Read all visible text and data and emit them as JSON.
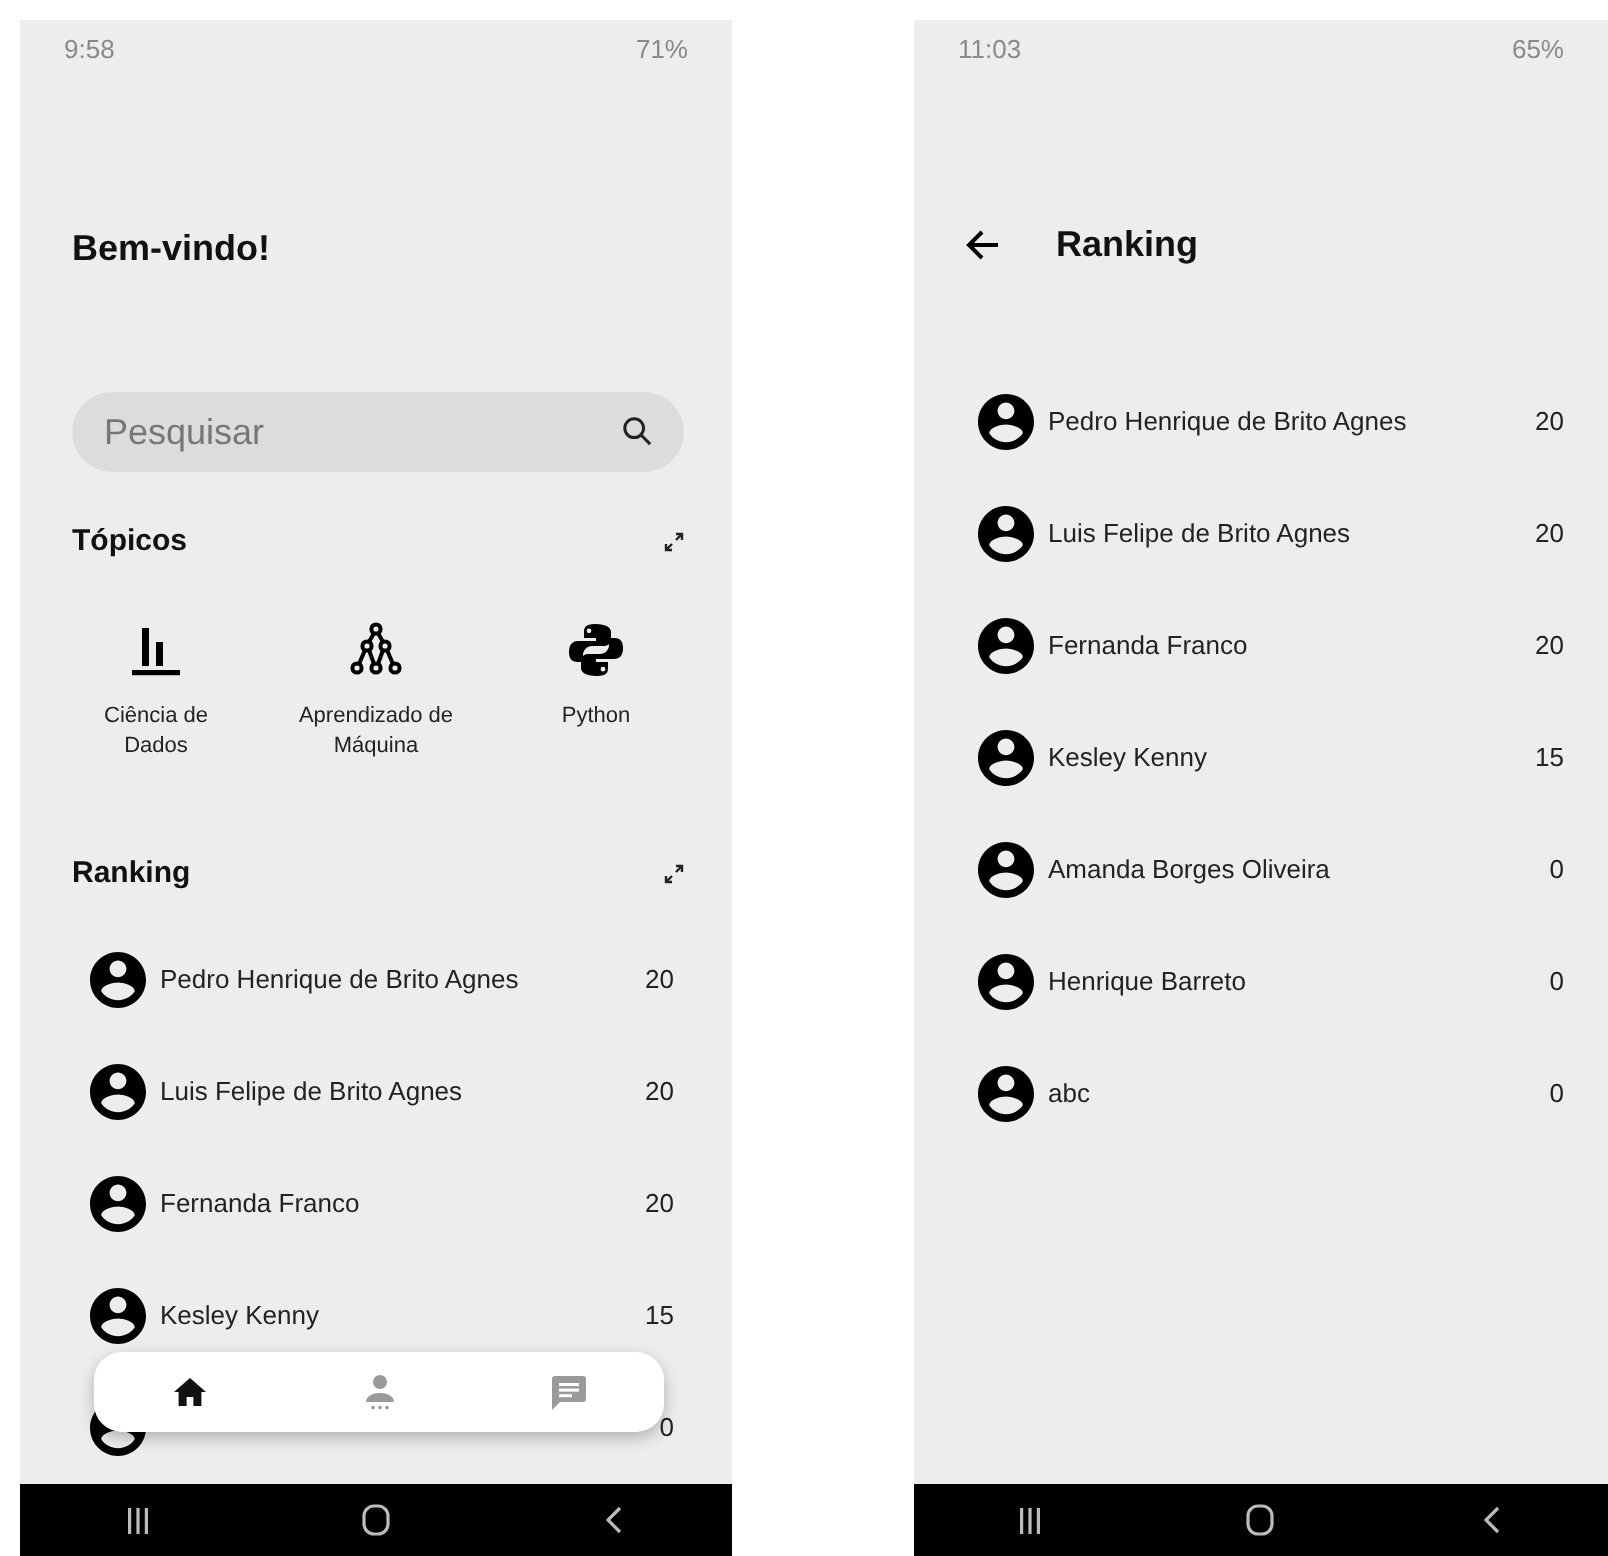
{
  "home_screen": {
    "status_bar": {
      "time": "9:58",
      "battery": "71%"
    },
    "title": "Bem-vindo!",
    "search": {
      "placeholder": "Pesquisar"
    },
    "topics": {
      "title": "Tópicos",
      "items": [
        {
          "kind": "chart",
          "label": "Ciência de Dados"
        },
        {
          "kind": "tree",
          "label": "Aprendizado de Máquina"
        },
        {
          "kind": "python",
          "label": "Python"
        }
      ]
    },
    "ranking": {
      "title": "Ranking",
      "rows": [
        {
          "name": "Pedro Henrique de Brito Agnes",
          "score": "20"
        },
        {
          "name": "Luis Felipe de Brito Agnes",
          "score": "20"
        },
        {
          "name": "Fernanda Franco",
          "score": "20"
        },
        {
          "name": "Kesley Kenny",
          "score": "15"
        },
        {
          "score": "0"
        }
      ]
    },
    "bottom_nav": [
      {
        "kind": "home",
        "selected": true
      },
      {
        "kind": "person",
        "selected": false
      },
      {
        "kind": "chat",
        "selected": false
      }
    ]
  },
  "ranking_screen": {
    "status_bar": {
      "time": "11:03",
      "battery": "65%"
    },
    "title": "Ranking",
    "rows": [
      {
        "name": "Pedro Henrique de Brito Agnes",
        "score": "20"
      },
      {
        "name": "Luis Felipe de Brito Agnes",
        "score": "20"
      },
      {
        "name": "Fernanda Franco",
        "score": "20"
      },
      {
        "name": "Kesley Kenny",
        "score": "15"
      },
      {
        "name": "Amanda Borges Oliveira",
        "score": "0"
      },
      {
        "name": "Henrique Barreto",
        "score": "0"
      },
      {
        "name": "abc",
        "score": "0"
      }
    ]
  }
}
